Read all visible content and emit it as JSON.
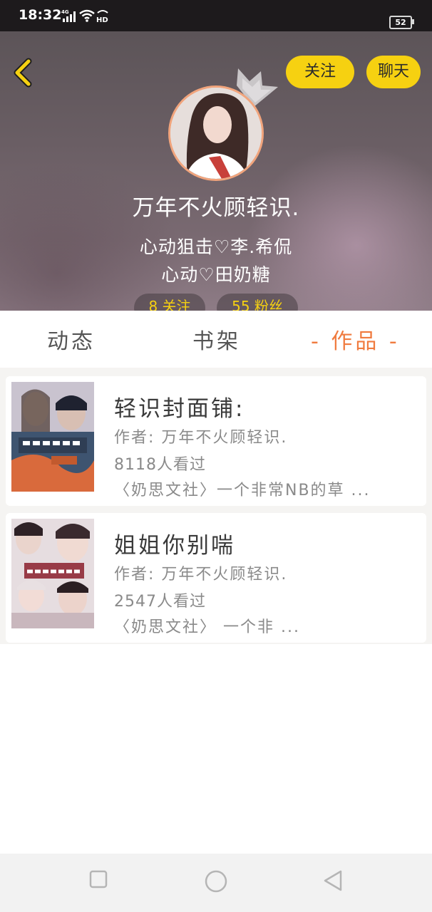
{
  "status_bar": {
    "time": "18:32",
    "network": "4G",
    "hd": "HD",
    "battery": "52"
  },
  "header": {
    "follow_label": "关注",
    "chat_label": "聊天",
    "username": "万年不火顾轻识.",
    "bio_line1": "心动狙击♡李.希侃",
    "bio_line2": "心动♡田奶糖",
    "following_label": "8 关注",
    "fans_label": "55 粉丝",
    "accent_color": "#f6d111"
  },
  "tabs": [
    {
      "label": "动态"
    },
    {
      "label": "书架"
    },
    {
      "label": "- 作品 -"
    }
  ],
  "works": [
    {
      "title": "轻识封面铺:",
      "author": "作者: 万年不火顾轻识.",
      "views": "8118人看过",
      "description": "〈奶思文社〉一个非常NB的草 ..."
    },
    {
      "title": "姐姐你别喘",
      "author": "作者: 万年不火顾轻识.",
      "views": "2547人看过",
      "description": "〈奶思文社〉 一个非 ..."
    }
  ],
  "colors": {
    "active_tab": "#f07b3f",
    "card_bg": "#ffffff",
    "list_bg": "#f5f4f2"
  }
}
